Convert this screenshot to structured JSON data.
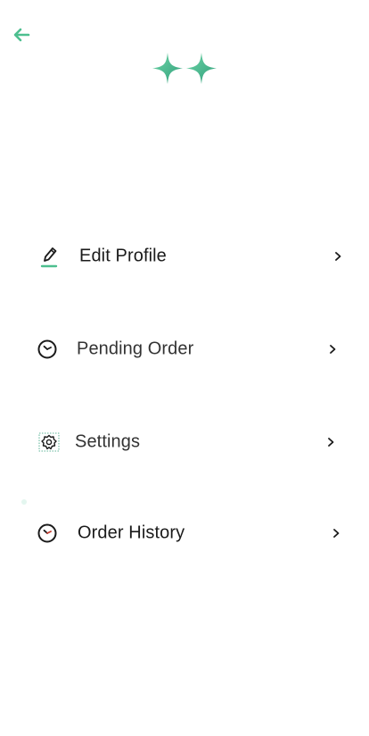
{
  "header": {
    "back_icon": "arrow-left-icon",
    "logo_icon": "sparkle-logo-icon"
  },
  "colors": {
    "accent": "#4dbf8f",
    "accent_dark": "#2f9e7a",
    "text": "#1a1a1a",
    "clock_hand": "#c0392b"
  },
  "menu": {
    "items": [
      {
        "label": "Edit Profile",
        "icon": "pencil-edit-icon"
      },
      {
        "label": "Pending Order",
        "icon": "clock-icon"
      },
      {
        "label": "Settings",
        "icon": "gear-icon"
      },
      {
        "label": "Order History",
        "icon": "clock-history-icon"
      }
    ],
    "chevron_icon": "chevron-right-icon"
  }
}
